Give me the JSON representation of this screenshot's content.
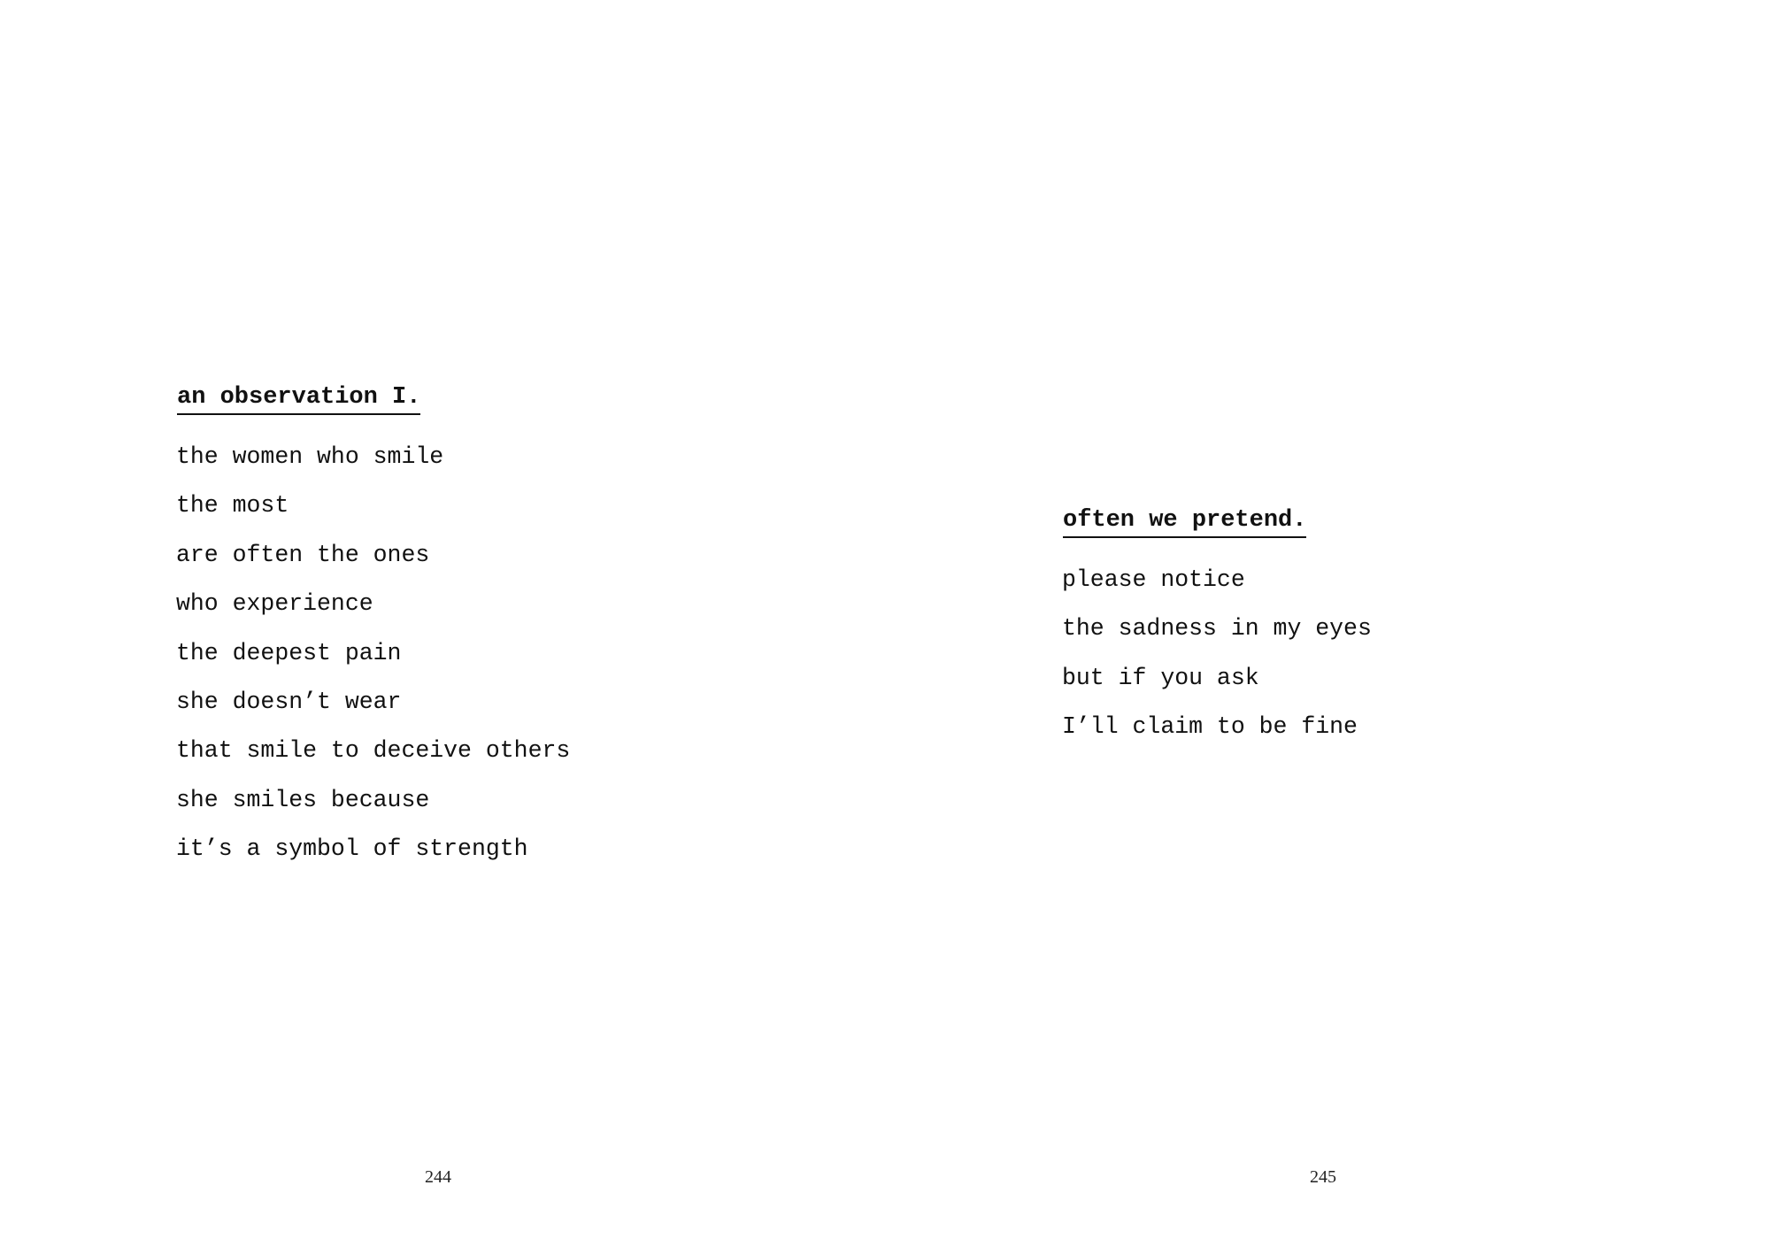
{
  "spread": {
    "left_page": {
      "poem": {
        "title": "an observation I.",
        "lines": [
          "the women who smile",
          "the most",
          "are often the ones",
          "who experience",
          "the deepest pain",
          "she doesn’t wear",
          "that smile to deceive others",
          "she smiles because",
          "it’s a symbol of strength"
        ]
      },
      "page_number": "244"
    },
    "right_page": {
      "poem": {
        "title": "often we pretend.",
        "lines": [
          "please notice",
          "the sadness in my eyes",
          "but if you ask",
          "I’ll claim to be fine"
        ]
      },
      "page_number": "245"
    }
  }
}
